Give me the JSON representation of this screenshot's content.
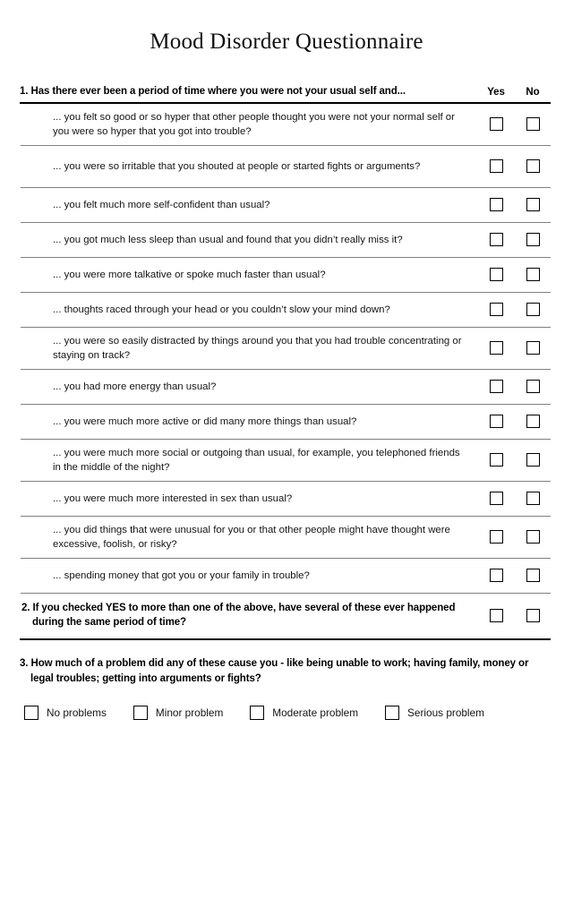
{
  "document": {
    "title": "Mood Disorder Questionnaire"
  },
  "question1": {
    "number": "1.",
    "prompt": "1. Has there ever been a period of time where you were not your usual self and...",
    "columns": {
      "yes": "Yes",
      "no": "No"
    },
    "items": [
      {
        "text": "... you felt so good or so hyper that other people thought you were not your normal self or you were so hyper that you got into trouble?",
        "lines": 2
      },
      {
        "text": "... you were so irritable that you shouted at people or started fights or arguments?",
        "lines": 2
      },
      {
        "text": "... you felt much more self-confident than usual?",
        "lines": 1
      },
      {
        "text": "... you got much less sleep than usual and found that you didn’t really miss it?",
        "lines": 1
      },
      {
        "text": "... you were more talkative or spoke much faster than usual?",
        "lines": 1
      },
      {
        "text": "... thoughts raced through your head or you couldn’t slow your mind down?",
        "lines": 1
      },
      {
        "text": "... you were so easily distracted by things around you that you had trouble concentrating or staying on track?",
        "lines": 2
      },
      {
        "text": "... you had more energy than usual?",
        "lines": 1
      },
      {
        "text": "... you were much more active or did many more things than usual?",
        "lines": 1
      },
      {
        "text": "... you were much more social or outgoing than usual, for example, you telephoned friends in the middle of the night?",
        "lines": 2
      },
      {
        "text": "... you were much more interested in sex than usual?",
        "lines": 1
      },
      {
        "text": "... you did things that were unusual for you or that other people might have thought were excessive, foolish, or risky?",
        "lines": 2
      },
      {
        "text": "... spending money that got you or your family in trouble?",
        "lines": 1
      }
    ]
  },
  "question2": {
    "prompt": "2. If you checked YES to more than one of the above, have several of these ever happened during the same period of time?"
  },
  "question3": {
    "prompt": "3. How much of a problem did any of these cause you - like being unable to work; having family, money or legal troubles; getting into arguments or fights?",
    "options": [
      {
        "label": "No problems"
      },
      {
        "label": "Minor problem"
      },
      {
        "label": "Moderate problem"
      },
      {
        "label": "Serious problem"
      }
    ]
  },
  "colors": {
    "text": "#000000",
    "rule_heavy": "#000000",
    "rule_light": "#808080",
    "background": "#ffffff"
  }
}
